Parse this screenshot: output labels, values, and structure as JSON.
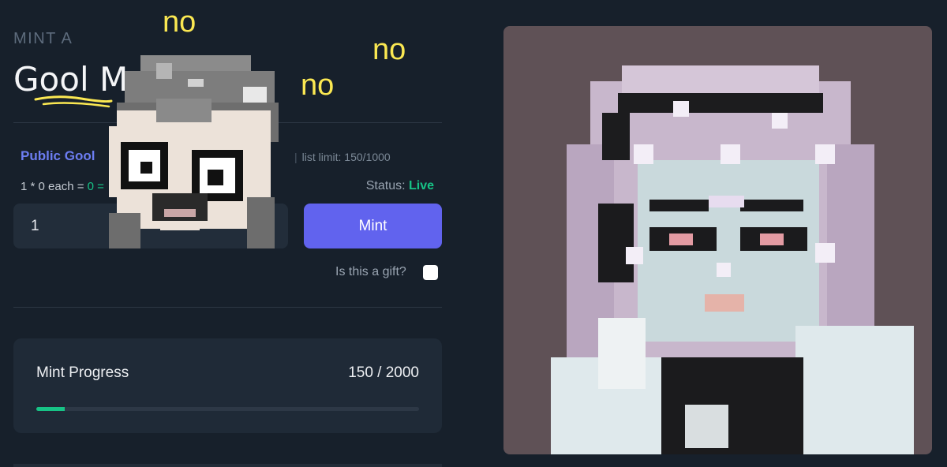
{
  "mint": {
    "eyebrow": "MINT A",
    "title": "Gool M",
    "phase_name": "Public Gool",
    "list_limit": "list limit: 150/1000",
    "price_prefix": "1 * 0 each = ",
    "price_total": "0 =",
    "status_label": "Status: ",
    "status_value": "Live",
    "quantity_value": "1",
    "mint_button": "Mint",
    "gift_label": "Is this a gift?",
    "gift_checked": false
  },
  "progress": {
    "label": "Mint Progress",
    "count": "150 / 2000",
    "fraction": 0.075
  },
  "annotations": {
    "no_1": "no",
    "no_2": "no",
    "no_3": "no"
  },
  "colors": {
    "accent_button": "#6163ee",
    "success": "#17c386",
    "annotation": "#fbe852",
    "artwork_background": "#5f5156"
  },
  "icons": {
    "gift_checkbox": "checkbox-unchecked",
    "sticker": "pixel-skull-girl-sticker",
    "artwork": "pixel-moon-girl-artwork"
  }
}
